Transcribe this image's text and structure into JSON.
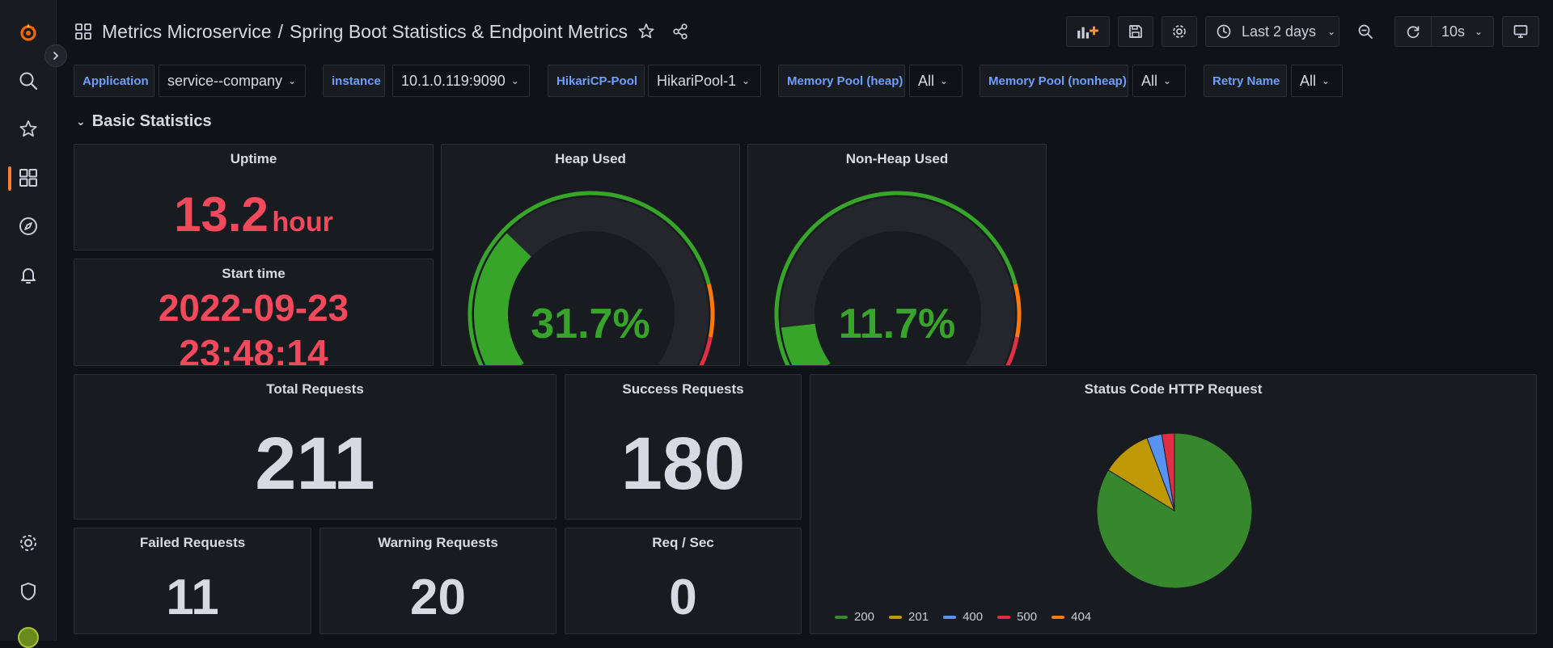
{
  "colors": {
    "accent": "#ff7d2e",
    "red": "#f2495c",
    "green": "#37a52a",
    "blue_label": "#6e9fff"
  },
  "header": {
    "folder": "Metrics Microservice",
    "separator": "/",
    "title": "Spring Boot Statistics & Endpoint Metrics",
    "time_range": "Last 2 days",
    "refresh_interval": "10s"
  },
  "variables": [
    {
      "label": "Application",
      "value": "service--company"
    },
    {
      "label": "instance",
      "value": "10.1.0.119:9090"
    },
    {
      "label": "HikariCP-Pool",
      "value": "HikariPool-1"
    },
    {
      "label": "Memory Pool (heap)",
      "value": "All"
    },
    {
      "label": "Memory Pool (nonheap)",
      "value": "All"
    },
    {
      "label": "Retry Name",
      "value": "All"
    }
  ],
  "row": {
    "title": "Basic Statistics"
  },
  "panels": {
    "uptime": {
      "title": "Uptime",
      "value": "13.2",
      "unit": "hour"
    },
    "start_time": {
      "title": "Start time",
      "date": "2022-09-23",
      "time": "23:48:14"
    },
    "heap": {
      "title": "Heap Used",
      "value": "31.7%",
      "fraction": 0.317
    },
    "nonheap": {
      "title": "Non-Heap Used",
      "value": "11.7%",
      "fraction": 0.117
    },
    "total_requests": {
      "title": "Total Requests",
      "value": "211"
    },
    "success_requests": {
      "title": "Success Requests",
      "value": "180"
    },
    "failed_requests": {
      "title": "Failed Requests",
      "value": "11"
    },
    "warning_requests": {
      "title": "Warning Requests",
      "value": "20"
    },
    "req_sec": {
      "title": "Req / Sec",
      "value": "0"
    },
    "status_code": {
      "title": "Status Code HTTP Request"
    }
  },
  "chart_data": {
    "type": "pie",
    "title": "Status Code HTTP Request",
    "series": [
      {
        "name": "200",
        "value": 160,
        "color": "#37872d"
      },
      {
        "name": "201",
        "value": 20,
        "color": "#c09a06"
      },
      {
        "name": "400",
        "value": 6,
        "color": "#5794f2"
      },
      {
        "name": "500",
        "value": 5,
        "color": "#e02f44"
      },
      {
        "name": "404",
        "value": 0,
        "color": "#ff780a"
      }
    ],
    "legend_placement": "bottom-left"
  }
}
